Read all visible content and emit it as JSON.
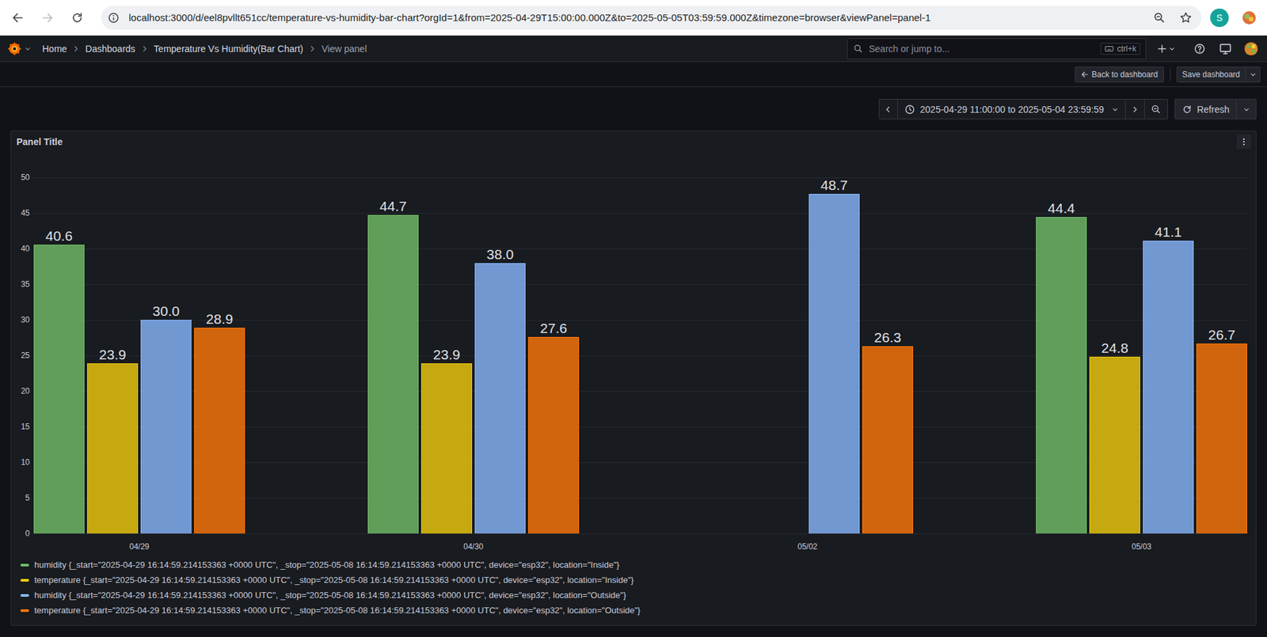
{
  "browser": {
    "url": "localhost:3000/d/eel8pvllt651cc/temperature-vs-humidity-bar-chart?orgId=1&from=2025-04-29T15:00:00.000Z&to=2025-05-05T03:59:59.000Z&timezone=browser&viewPanel=panel-1",
    "profile": "S",
    "can_go_back": true,
    "can_go_forward": false
  },
  "topbar": {
    "breadcrumbs": [
      {
        "label": "Home",
        "current": false
      },
      {
        "label": "Dashboards",
        "current": false
      },
      {
        "label": "Temperature Vs Humidity(Bar Chart)",
        "current": false
      },
      {
        "label": "View panel",
        "current": true
      }
    ],
    "search": {
      "placeholder": "Search or jump to...",
      "shortcut": "ctrl+k"
    }
  },
  "toolbar": {
    "back": "Back to dashboard",
    "save": "Save dashboard"
  },
  "time_picker": {
    "range": "2025-04-29 11:00:00 to 2025-05-04 23:59:59",
    "refresh": "Refresh"
  },
  "panel": {
    "title": "Panel Title",
    "chart": {
      "axis": {
        "min": 0,
        "max": 50,
        "ticks": [
          "0",
          "5",
          "10",
          "15",
          "20",
          "25",
          "30",
          "35",
          "40",
          "45",
          "50"
        ]
      },
      "categories": [
        "04/29",
        "04/30",
        "05/02",
        "05/03"
      ],
      "series": [
        {
          "name": "humidity {_start=\"2025-04-29 16:14:59.214153363 +0000 UTC\", _stop=\"2025-05-08 16:14:59.214153363 +0000 UTC\", device=\"esp32\", location=\"Inside\"}",
          "color": "#73bf69",
          "values": [
            40.6,
            44.7,
            null,
            44.4
          ],
          "labels": [
            "40.6",
            "44.7",
            null,
            "44.4"
          ]
        },
        {
          "name": "temperature {_start=\"2025-04-29 16:14:59.214153363 +0000 UTC\", _stop=\"2025-05-08 16:14:59.214153363 +0000 UTC\", device=\"esp32\", location=\"Inside\"}",
          "color": "#f2cc0c",
          "values": [
            23.9,
            23.9,
            null,
            24.8
          ],
          "labels": [
            "23.9",
            "23.9",
            null,
            "24.8"
          ]
        },
        {
          "name": "humidity {_start=\"2025-04-29 16:14:59.214153363 +0000 UTC\", _stop=\"2025-05-08 16:14:59.214153363 +0000 UTC\", device=\"esp32\", location=\"Outside\"}",
          "color": "#8ab8ff",
          "values": [
            30.0,
            38.0,
            48.7,
            41.1
          ],
          "labels": [
            "30.0",
            "38.0",
            "48.7",
            "41.1"
          ]
        },
        {
          "name": "temperature {_start=\"2025-04-29 16:14:59.214153363 +0000 UTC\", _stop=\"2025-05-08 16:14:59.214153363 +0000 UTC\", device=\"esp32\", location=\"Outside\"}",
          "color": "#ff780a",
          "values": [
            28.9,
            27.6,
            26.3,
            26.7
          ],
          "labels": [
            "28.9",
            "27.6",
            "26.3",
            "26.7"
          ]
        }
      ]
    }
  }
}
